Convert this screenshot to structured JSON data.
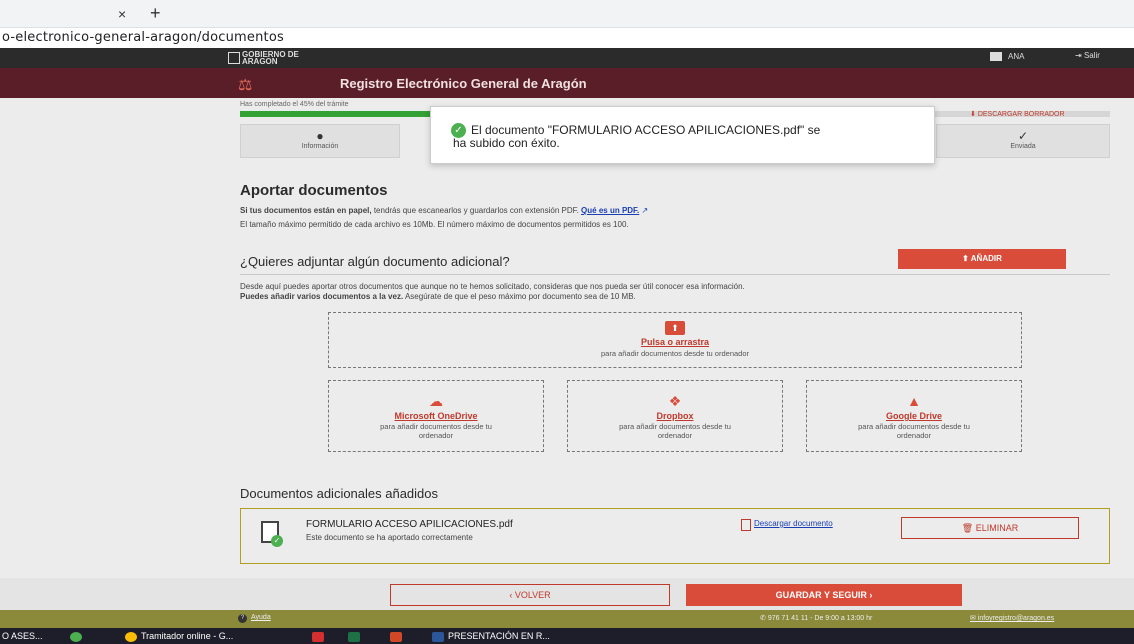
{
  "browser": {
    "tab_close": "×",
    "tab_new": "+",
    "url": "o-electronico-general-aragon/documentos"
  },
  "gov": {
    "logo_text": "GOBIERNO DE ARAGON",
    "user": "ANA",
    "exit": "Salir"
  },
  "app": {
    "title": "Registro Electrónico General de Aragón"
  },
  "progress": {
    "text": "Has completado el 45% del trámite",
    "percent": 45,
    "download_draft": "DESCARGAR BORRADOR",
    "steps": [
      {
        "label": "Información",
        "icon": "user-icon"
      },
      {
        "label": "Enviada",
        "icon": "check-icon"
      }
    ]
  },
  "toast": {
    "message": "El documento \"FORMULARIO ACCESO APILICACIONES.pdf\" se ha subido con éxito."
  },
  "main": {
    "heading": "Aportar documentos",
    "info1_bold": "Si tus documentos están en papel,",
    "info1_text": " tendrás que escanearlos y guardarlos con extensión PDF. ",
    "info1_link": "Qué es un PDF.",
    "info2": "El tamaño máximo permitido de cada archivo es 10Mb. El número máximo de documentos permitidos es 100.",
    "additional_heading": "¿Quieres adjuntar algún documento adicional?",
    "add_button": "AÑADIR",
    "desc1": "Desde aquí puedes aportar otros documentos que aunque no te hemos solicitado, consideras que nos pueda ser útil conocer esa información.",
    "desc2_bold": "Puedes añadir varios documentos a la vez.",
    "desc2_text": " Asegúrate de que el peso máximo por documento sea de 10 MB.",
    "dropzone": {
      "title": "Pulsa o arrastra",
      "sub": "para añadir documentos desde tu ordenador"
    },
    "clouds": [
      {
        "title": "Microsoft OneDrive",
        "sub": "para añadir documentos desde tu ordenador"
      },
      {
        "title": "Dropbox",
        "sub": "para añadir documentos desde tu ordenador"
      },
      {
        "title": "Google Drive",
        "sub": "para añadir documentos desde tu ordenador"
      }
    ],
    "added_heading": "Documentos adicionales añadidos",
    "added_doc": {
      "name": "FORMULARIO ACCESO APILICACIONES.pdf",
      "status": "Este documento se ha aportado correctamente",
      "download": "Descargar documento",
      "delete": "ELIMINAR"
    }
  },
  "footer": {
    "back": "VOLVER",
    "next": "GUARDAR Y SEGUIR",
    "help": "Ayuda",
    "phone": "976 71 41 11 - De 9:00 a 13:00 hr",
    "email": "infoyregistro@aragon.es"
  },
  "taskbar": {
    "items": [
      "O ASES...",
      "Tramitador online - G...",
      "PRESENTACIÓN EN R..."
    ]
  }
}
